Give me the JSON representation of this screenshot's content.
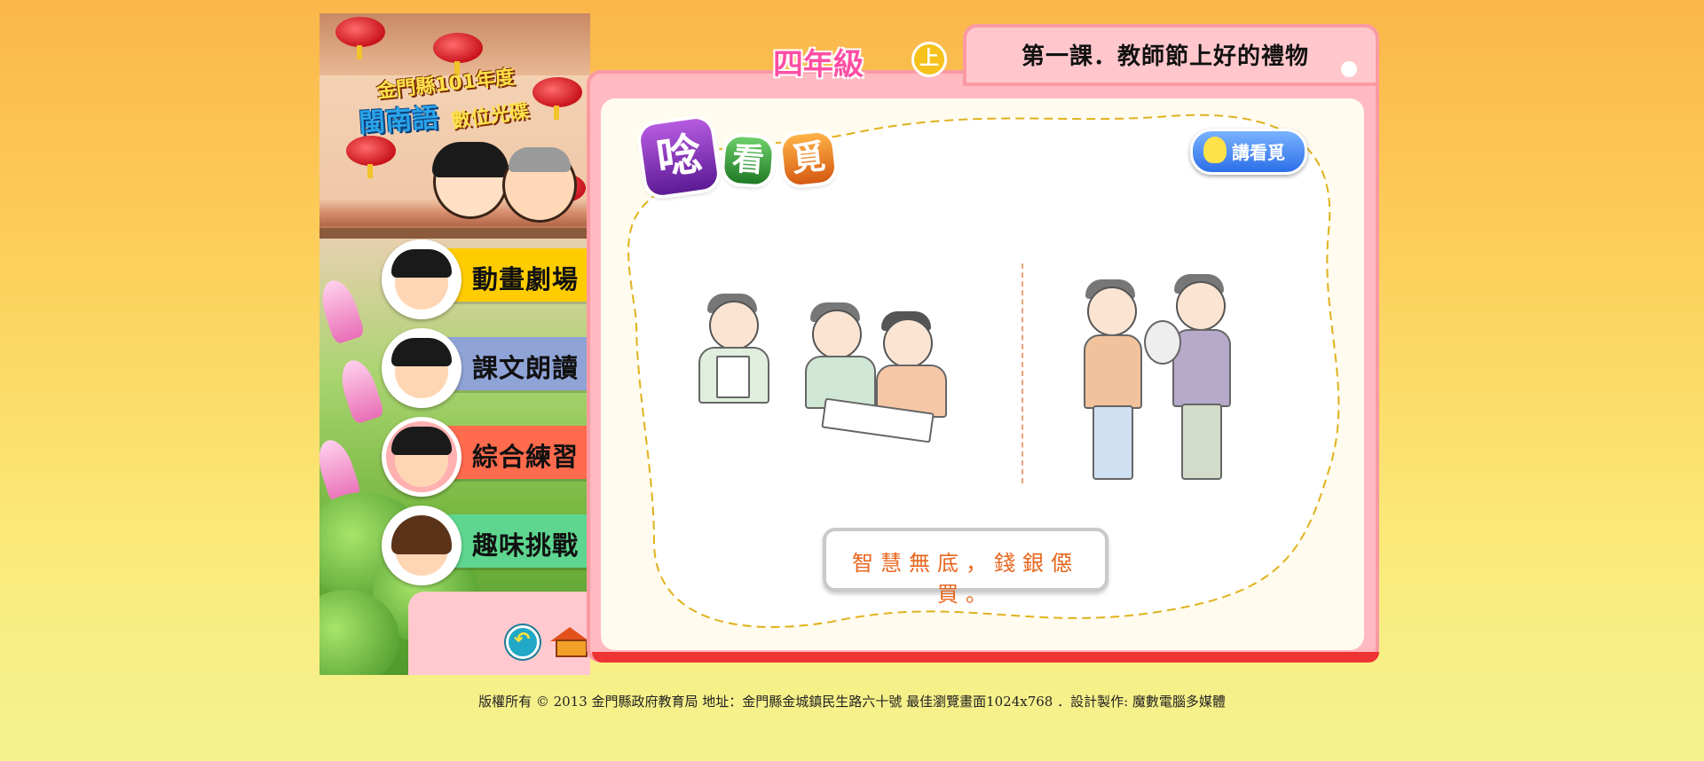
{
  "logo": {
    "line1": "金門縣101年度",
    "line2": "閩南語",
    "line3": "數位光碟"
  },
  "menu": [
    {
      "label": "動畫劇場",
      "color": "#ffcc00"
    },
    {
      "label": "課文朗讀",
      "color": "#8fa3d6"
    },
    {
      "label": "綜合練習",
      "color": "#ff6b4d"
    },
    {
      "label": "趣味挑戰",
      "color": "#5ed68f"
    }
  ],
  "grade": {
    "label": "四年級",
    "term": "上"
  },
  "lesson": {
    "title": "第一課．教師節上好的禮物"
  },
  "section": {
    "chars": [
      "唸",
      "看",
      "覓"
    ]
  },
  "speak_button": {
    "label": "講看覓"
  },
  "proverb": "智慧無底，錢銀僫買。",
  "footer": "版權所有 © 2013  金門縣政府教育局  地址：金門縣金城鎮民生路六十號  最佳瀏覽畫面1024x768  ．設計製作: 魔數電腦多媒體"
}
